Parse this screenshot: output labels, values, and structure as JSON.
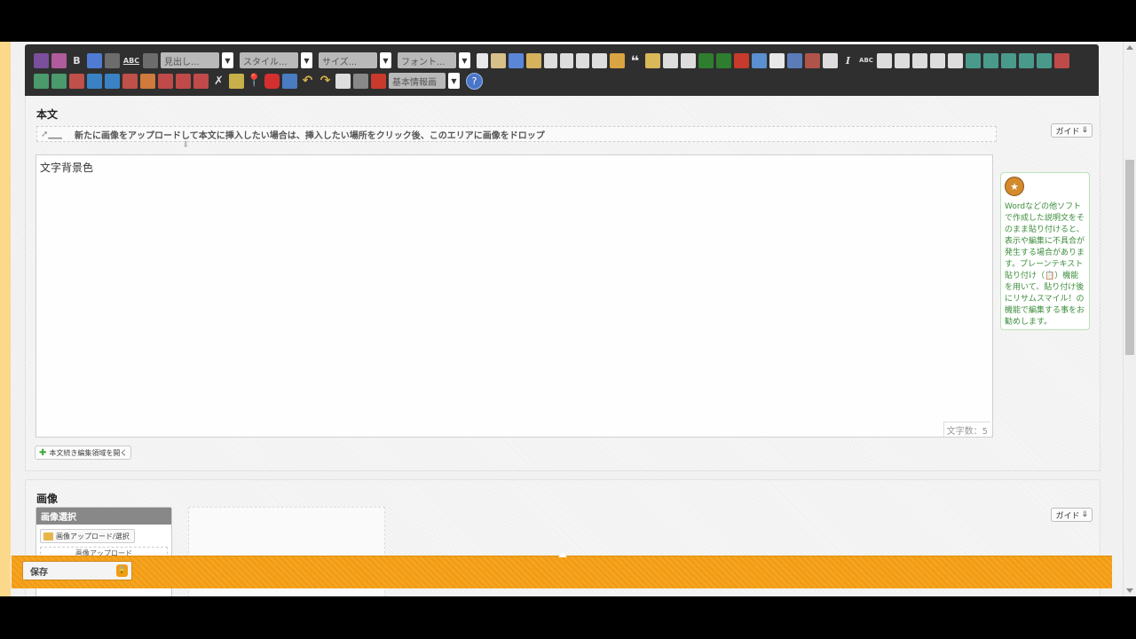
{
  "toolbar": {
    "combos": [
      {
        "label": "見出し..."
      },
      {
        "label": "スタイル..."
      },
      {
        "label": "サイズ..."
      },
      {
        "label": "フォント..."
      }
    ],
    "bold_label": "B",
    "abc_label": "ABC",
    "abc2_label": "ABC",
    "italic_label": "I",
    "basic_mode_label": "基本情報画",
    "help_label": "?"
  },
  "body_section": {
    "title": "本文",
    "guide_label": "ガイド",
    "drop_hint": "新たに画像をアップロードして本文に挿入したい場合は、挿入したい場所をクリック後、このエリアに画像をドロップ",
    "editor_text": "文字背景色",
    "char_count": "文字数：5",
    "open_area_label": "本文続き編集領域を開く",
    "tip_text": "Wordなどの他ソフトで作成した説明文をそのまま貼り付けると、表示や編集に不具合が発生する場合があります。プレーンテキスト貼り付け（📋）機能を用いて、貼り付け後にリサムスマイル！の機能で編集する事をお勧めします。"
  },
  "image_section": {
    "title": "画像",
    "guide_label": "ガイド",
    "panel_title": "画像選択",
    "upload_label": "画像アップロード/選択",
    "batch_label": "画像アップロード"
  },
  "savebar": {
    "save_label": "保存"
  }
}
